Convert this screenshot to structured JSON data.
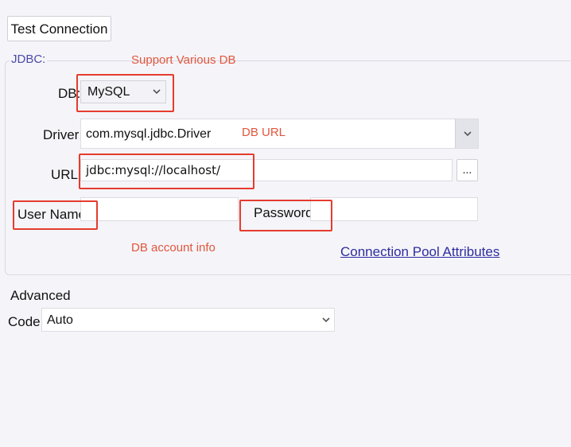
{
  "toolbar": {
    "test_connection_label": "Test Connection"
  },
  "jdbc": {
    "group_label": "JDBC:",
    "db": {
      "label": "DB:",
      "value": "MySQL"
    },
    "driver": {
      "label": "Driver:",
      "value": "com.mysql.jdbc.Driver"
    },
    "url": {
      "label": "URL:",
      "value": "jdbc:mysql://localhost/",
      "browse_label": "..."
    },
    "user": {
      "label": "User Name:",
      "value": ""
    },
    "password": {
      "label": "Password:",
      "value": ""
    },
    "pool_link": "Connection Pool Attributes"
  },
  "annotations": {
    "db": "Support Various DB",
    "url": "DB URL",
    "account": "DB account info",
    "color": "#e53c2e"
  },
  "advanced": {
    "title": "Advanced",
    "code": {
      "label": "Code:",
      "value": "Auto"
    }
  },
  "icons": {
    "dropdown": "chevron-down-icon"
  }
}
